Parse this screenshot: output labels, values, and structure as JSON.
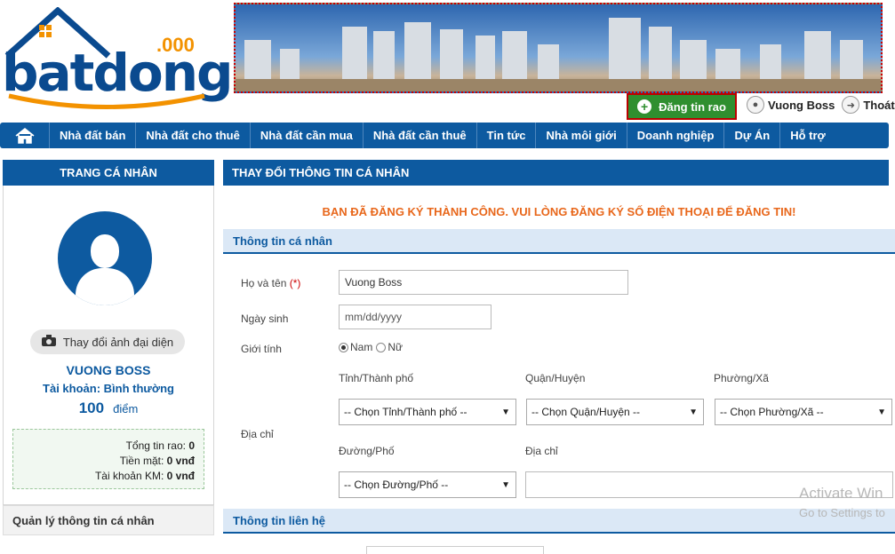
{
  "header": {
    "logo_text": "batdongsan",
    "logo_ext": ".000",
    "post_button": "Đăng tin rao",
    "user_name": "Vuong Boss",
    "logout": "Thoát"
  },
  "nav": {
    "items": [
      "Nhà đất bán",
      "Nhà đất cho thuê",
      "Nhà đất cần mua",
      "Nhà đất cần thuê",
      "Tin tức",
      "Nhà môi giới",
      "Doanh nghiệp",
      "Dự Án",
      "Hỗ trợ"
    ]
  },
  "sidebar": {
    "title": "TRANG CÁ NHÂN",
    "change_photo": "Thay đổi ảnh đại diện",
    "user_name": "VUONG BOSS",
    "account_type": "Tài khoản: Bình thường",
    "points_value": "100",
    "points_unit": "điểm",
    "stats": [
      {
        "label": "Tổng tin rao:",
        "value": "0"
      },
      {
        "label": "Tiền mặt:",
        "value": "0 vnđ"
      },
      {
        "label": "Tài khoản KM:",
        "value": "0 vnđ"
      }
    ],
    "manage_title": "Quản lý thông tin cá nhân"
  },
  "main": {
    "title": "THAY ĐỔI THÔNG TIN CÁ NHÂN",
    "success": "BẠN ĐÃ ĐĂNG KÝ THÀNH CÔNG. VUI LÒNG ĐĂNG KÝ SỐ ĐIỆN THOẠI ĐỂ ĐĂNG TIN!",
    "section_personal": "Thông tin cá nhân",
    "fullname_label": "Họ và tên",
    "required_mark": "(*)",
    "fullname_value": "Vuong Boss",
    "dob_label": "Ngày sinh",
    "dob_placeholder": "mm/dd/yyyy",
    "gender_label": "Giới tính",
    "gender_male": "Nam",
    "gender_female": "Nữ",
    "province_label": "Tỉnh/Thành phố",
    "district_label": "Quận/Huyện",
    "ward_label": "Phường/Xã",
    "address_label": "Địa chỉ",
    "street_label": "Đường/Phố",
    "address_detail_label": "Địa chỉ",
    "province_select": "-- Chọn Tỉnh/Thành phố --",
    "district_select": "-- Chọn Quận/Huyện --",
    "ward_select": "-- Chọn Phường/Xã --",
    "street_select": "-- Chọn Đường/Phố --",
    "section_contact": "Thông tin liên hệ"
  },
  "watermark": {
    "line1": "Activate Win",
    "line2": "Go to Settings to"
  },
  "colors": {
    "primary": "#0d5aa0",
    "accent": "#f39200",
    "success": "#e8671b",
    "post_button": "#2f8f2f"
  }
}
